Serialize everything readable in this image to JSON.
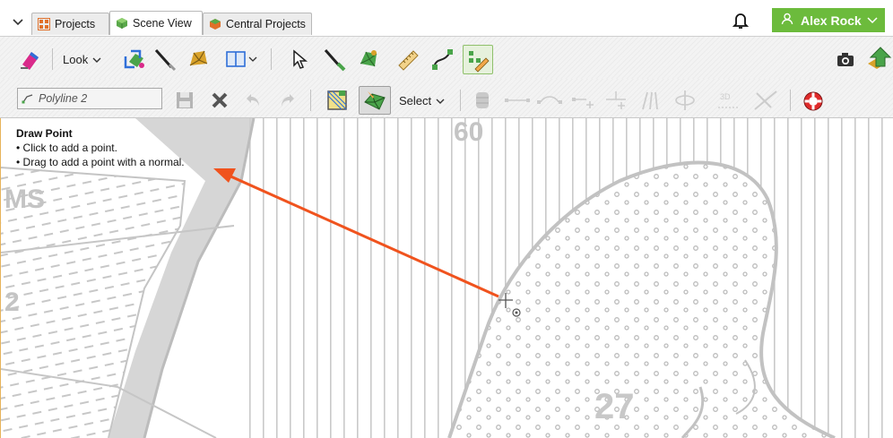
{
  "tabs": [
    {
      "label": "Projects",
      "icon": "projects-grid-icon",
      "active": false
    },
    {
      "label": "Scene View",
      "icon": "scene-cube-icon",
      "active": true
    },
    {
      "label": "Central Projects",
      "icon": "central-projects-icon",
      "active": false
    }
  ],
  "user": {
    "name": "Alex Rock",
    "icon": "user-icon",
    "menu_icon": "chevron-down-icon"
  },
  "toolbar": {
    "look_label": "Look",
    "select_label": "Select",
    "object_field_value": "Polyline 2"
  },
  "hint": {
    "title": "Draw Point",
    "lines": [
      "• Click to add a point.",
      "• Drag to add a point with a normal."
    ]
  },
  "map_labels": {
    "top_number": "60",
    "left_letters": "MS",
    "left_number": "2",
    "bottom_number": "27"
  },
  "colors": {
    "accent_green": "#6cbb3c",
    "annotation_arrow": "#f0531e",
    "map_gray": "#c7c7c7",
    "viewport_border": "#e7b35a"
  }
}
